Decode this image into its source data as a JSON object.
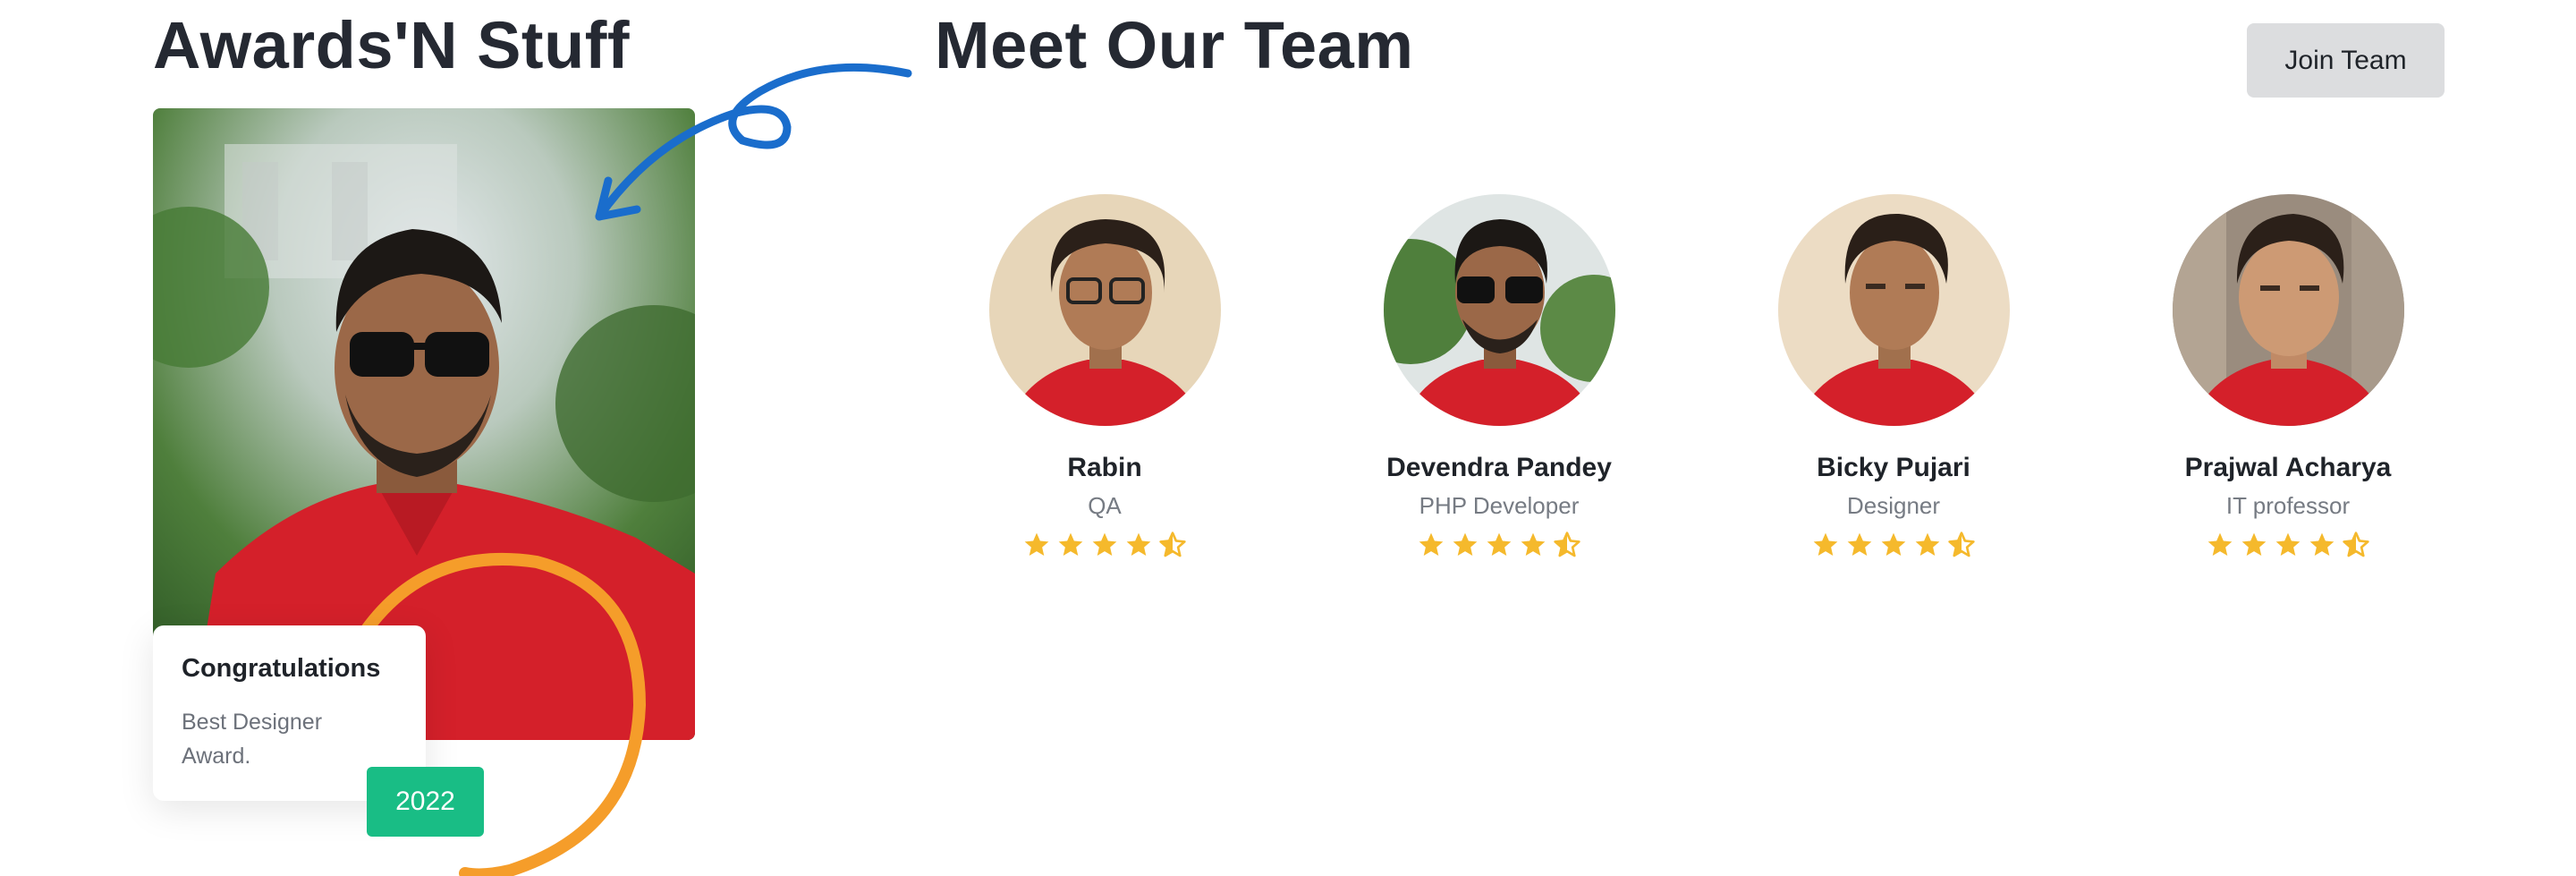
{
  "awards": {
    "heading": "Awards'N Stuff",
    "card_title": "Congratulations",
    "card_text": "Best Designer Award.",
    "year": "2022"
  },
  "team": {
    "heading": "Meet Our Team",
    "join_button": "Join Team",
    "members": [
      {
        "name": "Rabin",
        "role": "QA",
        "rating": 4.5
      },
      {
        "name": "Devendra Pandey",
        "role": "PHP Developer",
        "rating": 4.5
      },
      {
        "name": "Bicky Pujari",
        "role": "Designer",
        "rating": 4.5
      },
      {
        "name": "Prajwal Acharya",
        "role": "IT professor",
        "rating": 4.5
      }
    ]
  },
  "colors": {
    "star": "#f5b92c",
    "badge": "#19bd85",
    "ring": "#f59d2a",
    "arrow": "#1a6dcc",
    "shirt": "#d4202a"
  }
}
